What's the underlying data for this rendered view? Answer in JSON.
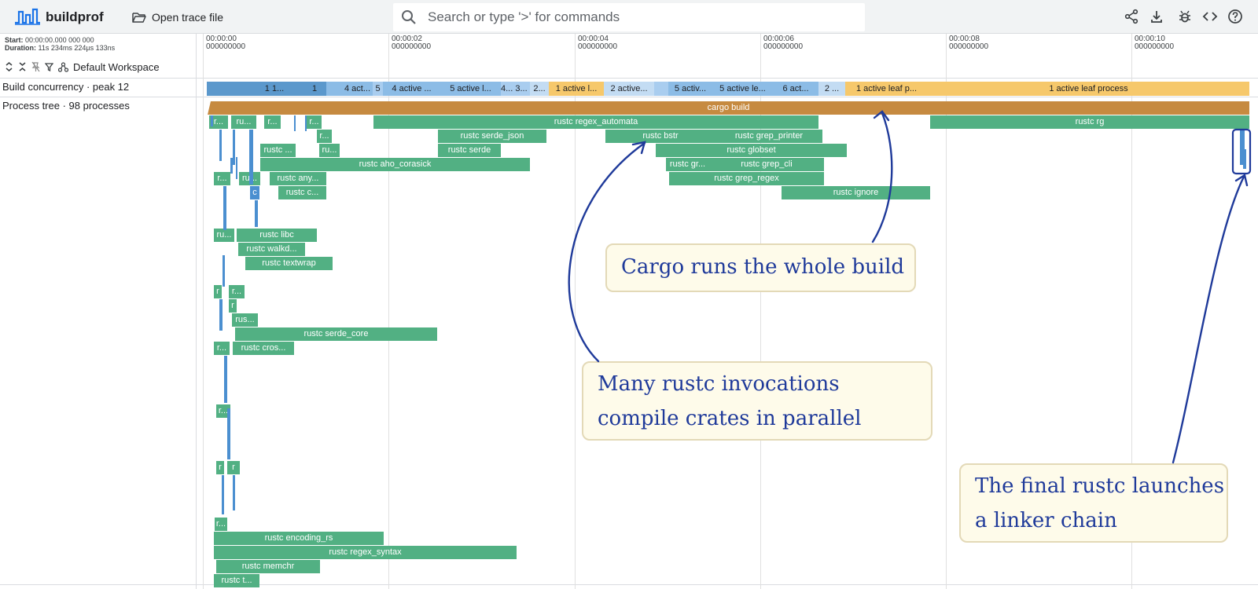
{
  "app": {
    "name": "buildprof"
  },
  "toolbar": {
    "open_label": "Open trace file",
    "search_placeholder": "Search or type '>' for commands"
  },
  "info": {
    "start_label": "Start:",
    "start_value": "00:00:00.000 000 000",
    "duration_label": "Duration:",
    "duration_value": "11s 234ms 224µs 133ns",
    "workspace": "Default Workspace"
  },
  "tracks": {
    "concurrency": "Build concurrency · peak 12",
    "process_tree": "Process tree · 98 processes"
  },
  "ticks": [
    {
      "time": "00:00:00",
      "sub": "000000000"
    },
    {
      "time": "00:00:02",
      "sub": "000000000"
    },
    {
      "time": "00:00:04",
      "sub": "000000000"
    },
    {
      "time": "00:00:06",
      "sub": "000000000"
    },
    {
      "time": "00:00:08",
      "sub": "000000000"
    },
    {
      "time": "00:00:10",
      "sub": "000000000"
    }
  ],
  "concurrency_segments": [
    {
      "label": "",
      "shade": "dark"
    },
    {
      "label": "1 1...",
      "shade": "dark"
    },
    {
      "label": "1",
      "shade": "dark"
    },
    {
      "label": "",
      "shade": "mid"
    },
    {
      "label": "4 act...",
      "shade": "mid"
    },
    {
      "label": "5",
      "shade": "light"
    },
    {
      "label": "4 active ...",
      "shade": "mid"
    },
    {
      "label": "5 active l...",
      "shade": "mid"
    },
    {
      "label": "4...",
      "shade": "light"
    },
    {
      "label": "3...",
      "shade": "light"
    },
    {
      "label": "2...",
      "shade": "pale"
    },
    {
      "label": "1 active l...",
      "shade": "yellow"
    },
    {
      "label": "2 active...",
      "shade": "pale"
    },
    {
      "label": "",
      "shade": "light"
    },
    {
      "label": "5 activ...",
      "shade": "mid"
    },
    {
      "label": "5 active le...",
      "shade": "mid"
    },
    {
      "label": "6 act...",
      "shade": "mid"
    },
    {
      "label": "2 ...",
      "shade": "pale"
    },
    {
      "label": "1 active leaf p...",
      "shade": "yellow"
    },
    {
      "label": "1 active leaf process",
      "shade": "yellow"
    }
  ],
  "process_bars": [
    {
      "label": "cargo build",
      "kind": "cargo"
    },
    {
      "label": "r...",
      "kind": "rustc"
    },
    {
      "label": "ru...",
      "kind": "rustc"
    },
    {
      "label": "r...",
      "kind": "rustc"
    },
    {
      "label": "r...",
      "kind": "rustc"
    },
    {
      "label": "rustc regex_automata",
      "kind": "rustc"
    },
    {
      "label": "rustc rg",
      "kind": "rustc"
    },
    {
      "label": "r...",
      "kind": "rustc"
    },
    {
      "label": "rustc serde_json",
      "kind": "rustc"
    },
    {
      "label": "rustc bstr",
      "kind": "rustc"
    },
    {
      "label": "rustc grep_printer",
      "kind": "rustc"
    },
    {
      "label": "rustc ...",
      "kind": "rustc"
    },
    {
      "label": "ru...",
      "kind": "rustc"
    },
    {
      "label": "rustc serde",
      "kind": "rustc"
    },
    {
      "label": "rustc globset",
      "kind": "rustc"
    },
    {
      "label": "rustc aho_corasick",
      "kind": "rustc"
    },
    {
      "label": "rustc gr...",
      "kind": "rustc"
    },
    {
      "label": "rustc grep_cli",
      "kind": "rustc"
    },
    {
      "label": "r...",
      "kind": "rustc"
    },
    {
      "label": "ru...",
      "kind": "rustc"
    },
    {
      "label": "rustc any...",
      "kind": "rustc"
    },
    {
      "label": "rustc grep_regex",
      "kind": "rustc"
    },
    {
      "label": "c",
      "kind": "link"
    },
    {
      "label": "rustc c...",
      "kind": "rustc"
    },
    {
      "label": "rustc ignore",
      "kind": "rustc"
    },
    {
      "label": "ru...",
      "kind": "rustc"
    },
    {
      "label": "rustc libc",
      "kind": "rustc"
    },
    {
      "label": "rustc walkd...",
      "kind": "rustc"
    },
    {
      "label": "rustc textwrap",
      "kind": "rustc"
    },
    {
      "label": "r",
      "kind": "rustc"
    },
    {
      "label": "r...",
      "kind": "rustc"
    },
    {
      "label": "r",
      "kind": "rustc"
    },
    {
      "label": "rus...",
      "kind": "rustc"
    },
    {
      "label": "rustc serde_core",
      "kind": "rustc"
    },
    {
      "label": "r...",
      "kind": "rustc"
    },
    {
      "label": "rustc cros...",
      "kind": "rustc"
    },
    {
      "label": "r...",
      "kind": "rustc"
    },
    {
      "label": "r",
      "kind": "rustc"
    },
    {
      "label": "r",
      "kind": "rustc"
    },
    {
      "label": "r...",
      "kind": "rustc"
    },
    {
      "label": "rustc encoding_rs",
      "kind": "rustc"
    },
    {
      "label": "rustc regex_syntax",
      "kind": "rustc"
    },
    {
      "label": "rustc memchr",
      "kind": "rustc"
    },
    {
      "label": "rustc t...",
      "kind": "rustc"
    }
  ],
  "annotations": {
    "cargo": "Cargo runs the whole build",
    "rustc_line1": "Many rustc invocations",
    "rustc_line2": "compile crates in parallel",
    "linker_line1": "The final rustc launches",
    "linker_line2": "a linker chain"
  },
  "colors": {
    "rustc": "#52b083",
    "cargo": "#c68a40",
    "link": "#4b8fd0",
    "concurrency_dark": "#5b98cc",
    "concurrency_mid": "#8cbce6",
    "concurrency_light": "#a9cdef",
    "concurrency_pale": "#c3dcf3",
    "concurrency_yellow": "#f6c86b",
    "annotation_text": "#1f3a9a"
  }
}
